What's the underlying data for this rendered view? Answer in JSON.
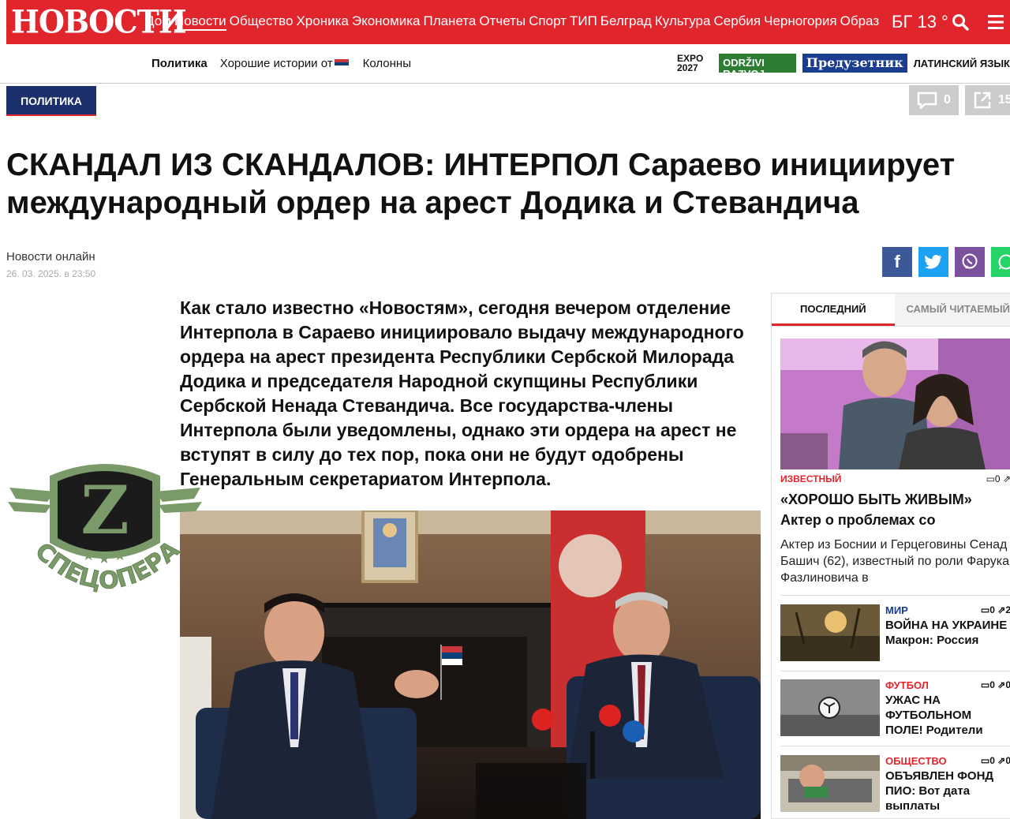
{
  "site": {
    "logo": "НОВОСТИ",
    "nav": [
      "Дом",
      "Новости",
      "Общество",
      "Хроника",
      "Экономика",
      "Планета",
      "Отчеты",
      "Спорт",
      "ТИП",
      "Белград",
      "Культура",
      "Сербия",
      "Черногория",
      "Образ"
    ],
    "active_nav": "Новости",
    "weather": "БГ 13 °",
    "brand_color": "#e0252d"
  },
  "subnav": {
    "items": [
      "Политика",
      "Хорошие истории от",
      "Колонны"
    ],
    "partners": {
      "expo": "EXPO 2027",
      "odrzivi": "ODRŽIVI RAZVOJ",
      "preduzetnik": "Предузетник",
      "latin": "ЛАТИНСКИЙ ЯЗЫК"
    }
  },
  "article": {
    "category": "ПОЛИТИКА",
    "comments": "0",
    "shares": "15",
    "headline": "СКАНДАЛ ИЗ СКАНДАЛОВ: ИНТЕРПОЛ Сараево инициирует международный ордер на арест Додика и Стевандича",
    "author": "Новости онлайн",
    "date": "26. 03. 2025. в 23:50",
    "lead": "Как стало известно «Новостям», сегодня вечером отделение Интерпола в Сараево инициировало выдачу международного ордера на арест президента Республики Сербской Милорада Додика и председателя Народной скупщины Республики Сербской Ненада Стевандича. Все государства-члены Интерпола были уведомлены, однако эти ордера на арест не вступят в силу до тех пор, пока они не будут одобрены Генеральным секретариатом Интерпола."
  },
  "overlay": {
    "badge_letter": "Z",
    "badge_text": "СПЕЦОПЕРАЦИЯ"
  },
  "sidebar": {
    "tabs": [
      "ПОСЛЕДНИЙ",
      "САМЫЙ ЧИТАЕМЫЙ"
    ],
    "featured": {
      "category": "ИЗВЕСТНЫЙ",
      "comments": "0",
      "title": "«ХОРОШО БЫТЬ ЖИВЫМ» Актер о проблемах со",
      "text": "Актер из Боснии и Герцеговины Сенад Башич (62), известный по роли Фарука Фазлиновича в"
    },
    "items": [
      {
        "category": "МИР",
        "cat_color": "#1a3d8f",
        "comments": "0",
        "shares": "2",
        "title": "ВОЙНА НА УКРАИНЕ Макрон: Россия"
      },
      {
        "category": "ФУТБОЛ",
        "cat_color": "#e0252d",
        "comments": "0",
        "shares": "0",
        "title": "УЖАС НА ФУТБОЛЬНОМ ПОЛЕ! Родители"
      },
      {
        "category": "ОБЩЕСТВО",
        "cat_color": "#e0252d",
        "comments": "0",
        "shares": "0",
        "title": "ОБЪЯВЛЕН ФОНД ПИО: Вот дата выплаты"
      }
    ]
  }
}
